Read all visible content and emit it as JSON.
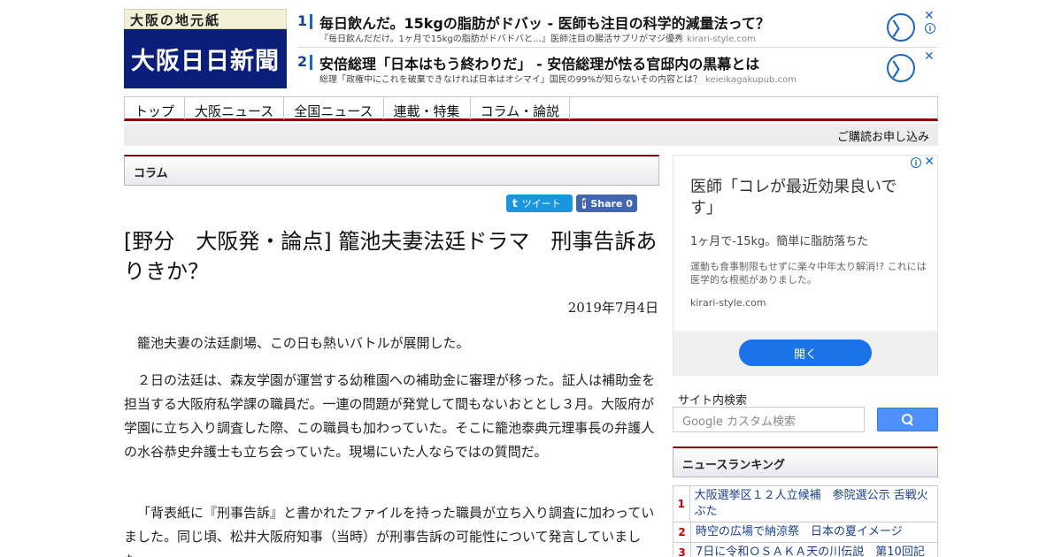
{
  "header": {
    "logo_tagline": "大阪の地元紙",
    "logo_name": "大阪日日新聞"
  },
  "top_ads": [
    {
      "num": "1",
      "title": "毎日飲んだ。15kgの脂肪がドバッ - 医師も注目の科学的減量法って？",
      "sub": "『毎日飲んだだけ。1ヶ月で15kgの脂肪がドバドバと…』医師注目の腸活サプリがマジ優秀",
      "domain": "kirari-style.com",
      "arrow": "〉",
      "close": "✕",
      "info": "i"
    },
    {
      "num": "2",
      "title": "安倍総理「日本はもう終わりだ」 - 安倍総理が怯る官邸内の黒幕とは",
      "sub": "総理「政権中にこれを破棄できなければ日本はオシマイ」国民の99%が知らないその内容とは？",
      "domain": "keieikagakupub.com",
      "arrow": "〉",
      "close": "✕"
    }
  ],
  "nav": {
    "items": [
      "トップ",
      "大阪ニュース",
      "全国ニュース",
      "連載・特集",
      "コラム・論説"
    ],
    "subscribe": "ご購読お申し込み"
  },
  "section": {
    "label": "コラム"
  },
  "share": {
    "tweet_icon": "t",
    "tweet_label": "ツイート",
    "fb_icon": "f",
    "fb_label": "Share 0"
  },
  "article": {
    "title": "[野分　大阪発・論点] 籠池夫妻法廷ドラマ　刑事告訴ありきか？",
    "date": "2019年7月4日",
    "paragraphs": [
      "籠池夫妻の法廷劇場、この日も熱いバトルが展開した。",
      "２日の法廷は、森友学園が運営する幼稚園への補助金に審理が移った。証人は補助金を担当する大阪府私学課の職員だ。一連の問題が発覚して間もないおととし３月。大阪府が学園に立ち入り調査した際、この職員も加わっていた。そこに籠池泰典元理事長の弁護人の水谷恭史弁護士も立ち会っていた。現場にいた人ならではの質問だ。",
      "「背表紙に『刑事告訴』と書かれたファイルを持った職員が立ち入り調査に加わっていました。同じ頃、松井大阪府知事（当時）が刑事告訴の可能性について発言していました。"
    ]
  },
  "side_ad": {
    "info": "i",
    "close": "✕",
    "title": "医師「コレが最近効果良いです」",
    "line1": "1ヶ月で-15kg。簡単に脂肪落ちた",
    "line2": "運動も食事制限もせずに楽々中年太り解消!? これには医学的な根拠がありました。",
    "domain": "kirari-style.com",
    "button": "開く"
  },
  "search": {
    "label": "サイト内検索",
    "placeholder": "Google カスタム検索",
    "button_icon": "search-icon"
  },
  "ranking": {
    "title": "ニュースランキング",
    "items": [
      {
        "rank": "1",
        "text": "大阪選挙区１２人立候補　参院選公示 舌戦火ぶた"
      },
      {
        "rank": "2",
        "text": "時空の広場で納涼祭　日本の夏イメージ"
      },
      {
        "rank": "3",
        "text": "7日に令和ＯＳＡＫＡ天の川伝説　第10回記"
      }
    ]
  },
  "colors": {
    "accent_red": "#8b0a0a",
    "logo_navy": "#0b1f7a",
    "link_blue": "#1a3f8f",
    "twitter": "#1b95e0",
    "facebook": "#4267b2",
    "ad_button": "#1a73e8"
  }
}
